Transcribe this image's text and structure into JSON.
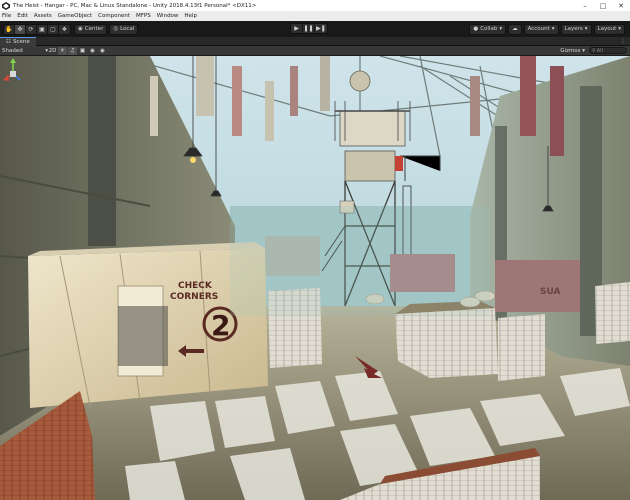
{
  "window": {
    "title": "The Heist - Hangar - PC, Mac & Linux Standalone - Unity 2018.4.13f1 Personal* <DX11>"
  },
  "menu": [
    "File",
    "Edit",
    "Assets",
    "GameObject",
    "Component",
    "MFPS",
    "Window",
    "Help"
  ],
  "toolbar": {
    "center_label": "Center",
    "local_label": "Local",
    "collab_label": "Collab",
    "account_label": "Account",
    "layers_label": "Layers",
    "layout_label": "Layout"
  },
  "scene_tab": {
    "label": "Scene"
  },
  "scene_toolbar": {
    "shading_mode": "Shaded",
    "mode_2d": "2D",
    "gizmos_label": "Gizmos",
    "search_prefix": "All"
  },
  "scene": {
    "sign_line1": "CHECK",
    "sign_line2": "CORNERS",
    "sign_number": "2",
    "crate_text": "SUA"
  },
  "colors": {
    "title_bg": "#ffffff",
    "menu_bg": "#ececec",
    "toolbar_bg": "#191919",
    "accent_tab": "#5a9be2",
    "sky": "#b9d6de",
    "floor": "#a09a82"
  },
  "icons": {
    "hand": "hand-tool-icon",
    "move": "move-tool-icon",
    "rotate": "rotate-tool-icon",
    "scale": "scale-tool-icon",
    "rect": "rect-tool-icon",
    "transform": "transform-tool-icon",
    "play": "play-icon",
    "pause": "pause-icon",
    "step": "step-icon",
    "cloud": "cloud-icon"
  }
}
